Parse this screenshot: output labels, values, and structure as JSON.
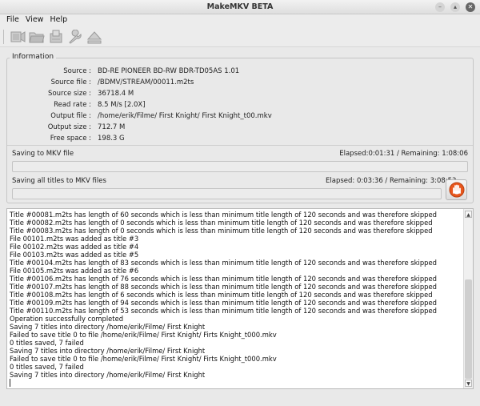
{
  "window": {
    "title": "MakeMKV BETA",
    "minimize_glyph": "–",
    "maximize_glyph": "▴",
    "close_glyph": "✕"
  },
  "menu": [
    "File",
    "View",
    "Help"
  ],
  "toolbar": {
    "icons": [
      "open-disc-icon",
      "open-files-icon",
      "backup-icon",
      "settings-wrench-icon",
      "eject-icon"
    ]
  },
  "info": {
    "title": "Information",
    "rows": [
      {
        "label": "Source :",
        "value": "BD-RE PIONEER BD-RW BDR-TD05AS 1.01"
      },
      {
        "label": "Source file :",
        "value": "/BDMV/STREAM/00011.m2ts"
      },
      {
        "label": "Source size :",
        "value": "36718.4 M"
      },
      {
        "label": "Read rate :",
        "value": "8.5 M/s [2.0X]"
      },
      {
        "label": "Output file :",
        "value": "/home/erik/Filme/ First Knight/ First Knight_t00.mkv"
      },
      {
        "label": "Output size :",
        "value": "712.7 M"
      },
      {
        "label": "Free space :",
        "value": "198.3 G"
      }
    ]
  },
  "progress": {
    "current": {
      "label": "Saving to MKV file",
      "time": "Elapsed:0:01:31 / Remaining: 1:08:06",
      "fraction": 0
    },
    "total": {
      "label": "Saving all titles to MKV files",
      "time": "Elapsed: 0:03:36 / Remaining: 3:08:53",
      "fraction": 0
    }
  },
  "stop_button": {
    "icon": "stop-hand-icon",
    "color": "#e8571e"
  },
  "log": [
    "Title #00081.m2ts has length of 60 seconds which is less than minimum title length of 120 seconds and was therefore skipped",
    "Title #00082.m2ts has length of 0 seconds which is less than minimum title length of 120 seconds and was therefore skipped",
    "Title #00083.m2ts has length of 0 seconds which is less than minimum title length of 120 seconds and was therefore skipped",
    "File 00101.m2ts was added as title #3",
    "File 00102.m2ts was added as title #4",
    "File 00103.m2ts was added as title #5",
    "Title #00104.m2ts has length of 83 seconds which is less than minimum title length of 120 seconds and was therefore skipped",
    "File 00105.m2ts was added as title #6",
    "Title #00106.m2ts has length of 76 seconds which is less than minimum title length of 120 seconds and was therefore skipped",
    "Title #00107.m2ts has length of 88 seconds which is less than minimum title length of 120 seconds and was therefore skipped",
    "Title #00108.m2ts has length of 6 seconds which is less than minimum title length of 120 seconds and was therefore skipped",
    "Title #00109.m2ts has length of 94 seconds which is less than minimum title length of 120 seconds and was therefore skipped",
    "Title #00110.m2ts has length of 53 seconds which is less than minimum title length of 120 seconds and was therefore skipped",
    "Operation successfully completed",
    "Saving 7 titles into directory /home/erik/Filme/ First Knight",
    "Failed to save title 0 to file /home/erik/Filme/ First Knight/ Firts Knight_t000.mkv",
    "0 titles saved, 7 failed",
    "Saving 7 titles into directory /home/erik/Filme/ First Knight",
    "Failed to save title 0 to file /home/erik/Filme/ First Knight/ Firts Knight_t000.mkv",
    "0 titles saved, 7 failed",
    "Saving 7 titles into directory /home/erik/Filme/ First Knight"
  ],
  "scroll": {
    "up_glyph": "▲",
    "down_glyph": "▼"
  }
}
